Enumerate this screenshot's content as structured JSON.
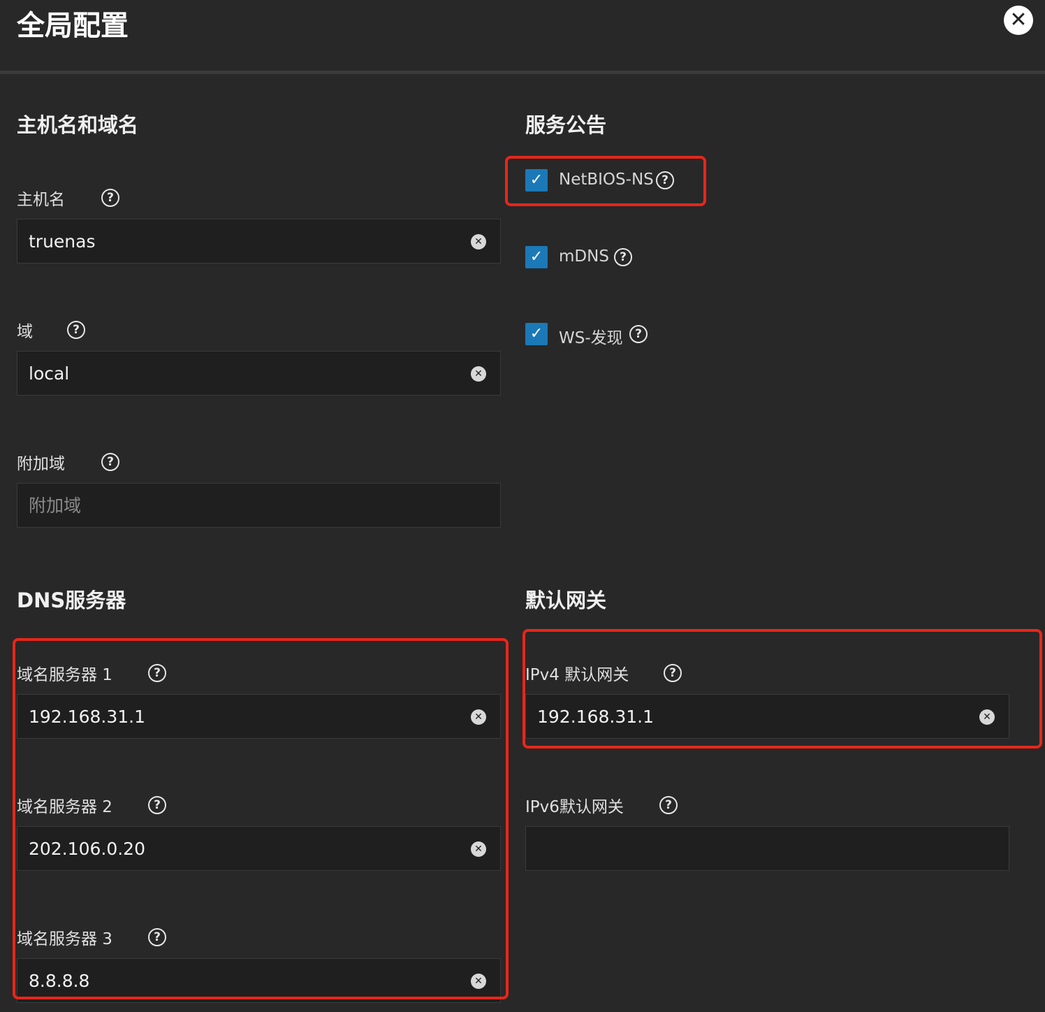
{
  "dialog": {
    "title": "全局配置",
    "close_icon": "close-icon"
  },
  "hostname_section": {
    "title": "主机名和域名",
    "hostname": {
      "label": "主机名",
      "value": "truenas"
    },
    "domain": {
      "label": "域",
      "value": "local"
    },
    "additional_domains": {
      "label": "附加域",
      "placeholder": "附加域",
      "value": ""
    }
  },
  "service_announcement": {
    "title": "服务公告",
    "items": [
      {
        "label": "NetBIOS-NS",
        "checked": true
      },
      {
        "label": "mDNS",
        "checked": true
      },
      {
        "label": "WS-发现",
        "checked": true
      }
    ]
  },
  "dns_section": {
    "title": "DNS服务器",
    "servers": [
      {
        "label": "域名服务器 1",
        "value": "192.168.31.1"
      },
      {
        "label": "域名服务器 2",
        "value": "202.106.0.20"
      },
      {
        "label": "域名服务器 3",
        "value": "8.8.8.8"
      }
    ]
  },
  "gateway_section": {
    "title": "默认网关",
    "ipv4": {
      "label": "IPv4 默认网关",
      "value": "192.168.31.1"
    },
    "ipv6": {
      "label": "IPv6默认网关",
      "value": ""
    }
  },
  "colors": {
    "background": "#282828",
    "field": "#1f1f1f",
    "checkbox": "#1b79b8",
    "highlight": "#e8261a"
  }
}
